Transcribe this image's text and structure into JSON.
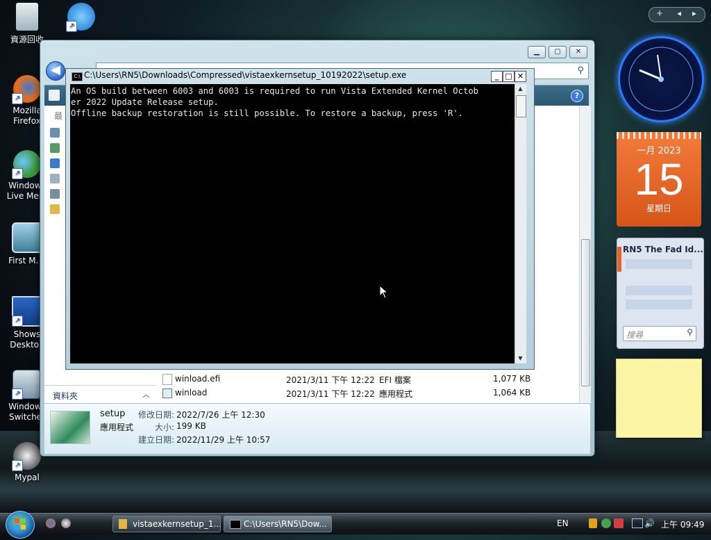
{
  "desktop": {
    "icons": [
      {
        "label": "資源回收"
      },
      {
        "label": "Mozilla Firefox"
      },
      {
        "label": "Windows Live Mess"
      },
      {
        "label": "First M. L"
      },
      {
        "label": "Shows Desktop"
      },
      {
        "label": "Windows Switcher"
      },
      {
        "label": "Mypal"
      }
    ]
  },
  "explorer": {
    "nav_truncated_label": "最",
    "folders_label": "資料夾",
    "files": [
      {
        "name": "winload.efi",
        "date": "2021/3/11 下午 12:22",
        "type": "EFI 檔案",
        "size": "1,077 KB"
      },
      {
        "name": "winload",
        "date": "2021/3/11 下午 12:22",
        "type": "應用程式",
        "size": "1,064 KB"
      }
    ],
    "details": {
      "name": "setup",
      "kind": "應用程式",
      "modified_label": "修改日期:",
      "modified_value": "2022/7/26 上午 12:30",
      "size_label": "大小:",
      "size_value": "199 KB",
      "created_label": "建立日期:",
      "created_value": "2022/11/29 上午 10:57"
    }
  },
  "console": {
    "title": "C:\\Users\\RN5\\Downloads\\Compressed\\vistaexkernsetup_10192022\\setup.exe",
    "icon_text": "C:\\",
    "lines": [
      "An OS build between 6003 and 6003 is required to run Vista Extended Kernel Octob",
      "er 2022 Update Release setup.",
      "Offline backup restoration is still possible. To restore a backup, press 'R'."
    ]
  },
  "gadgets": {
    "calendar": {
      "month": "一月 2023",
      "day": "15",
      "weekday": "星期日"
    },
    "feed": {
      "title": "RN5 The Fad Id...",
      "search_placeholder": "搜尋"
    }
  },
  "taskbar": {
    "buttons": [
      {
        "label": "vistaexkernsetup_1..."
      },
      {
        "label": "C:\\Users\\RN5\\Dow..."
      }
    ],
    "language": "EN",
    "clock": "上午 09:49"
  }
}
